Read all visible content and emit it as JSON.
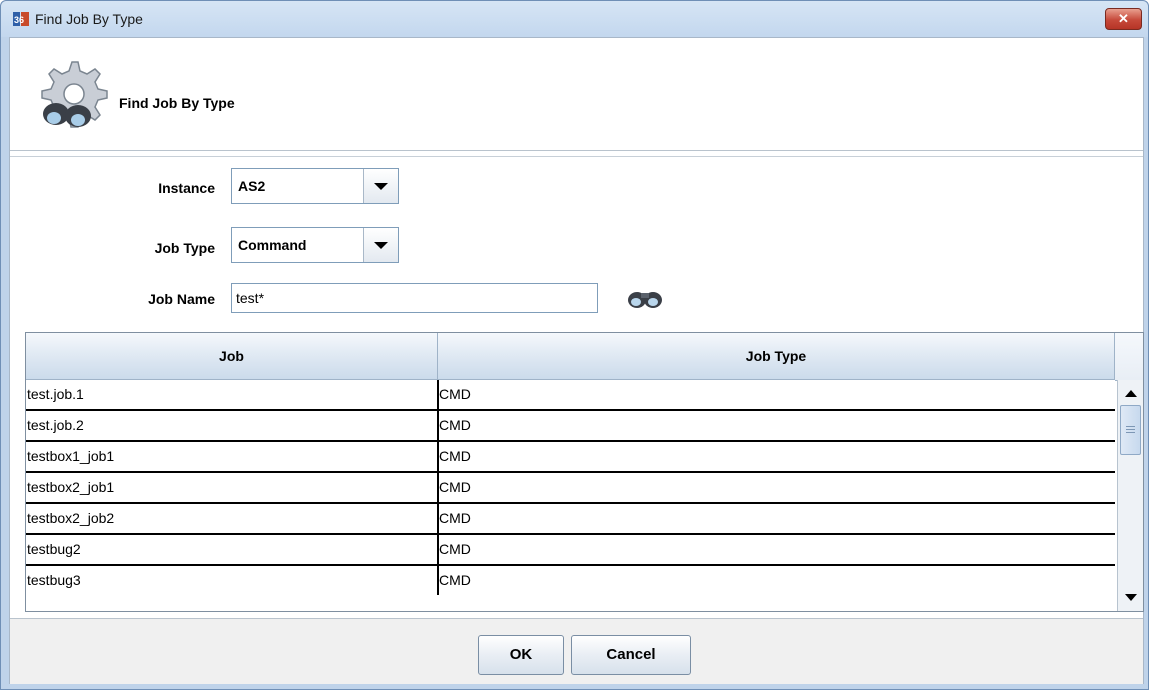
{
  "window": {
    "title": "Find Job By Type",
    "close_glyph": "✕",
    "app_icon": "app-logo-icon"
  },
  "header": {
    "title": "Find Job By Type",
    "icon": "gear-binoculars-icon"
  },
  "form": {
    "instance": {
      "label": "Instance",
      "value": "AS2"
    },
    "job_type": {
      "label": "Job Type",
      "value": "Command"
    },
    "job_name": {
      "label": "Job Name",
      "value": "test*"
    },
    "search_icon": "binoculars-icon"
  },
  "table": {
    "columns": [
      "Job",
      "Job Type"
    ],
    "rows": [
      {
        "job": "test.job.1",
        "type": "CMD"
      },
      {
        "job": "test.job.2",
        "type": "CMD"
      },
      {
        "job": "testbox1_job1",
        "type": "CMD"
      },
      {
        "job": "testbox2_job1",
        "type": "CMD"
      },
      {
        "job": "testbox2_job2",
        "type": "CMD"
      },
      {
        "job": "testbug2",
        "type": "CMD"
      },
      {
        "job": "testbug3",
        "type": "CMD"
      }
    ]
  },
  "buttons": {
    "ok": "OK",
    "cancel": "Cancel"
  },
  "colors": {
    "title_bar": "#c9dcf0",
    "close_button": "#c6493a",
    "grid_lines": "#000000"
  }
}
